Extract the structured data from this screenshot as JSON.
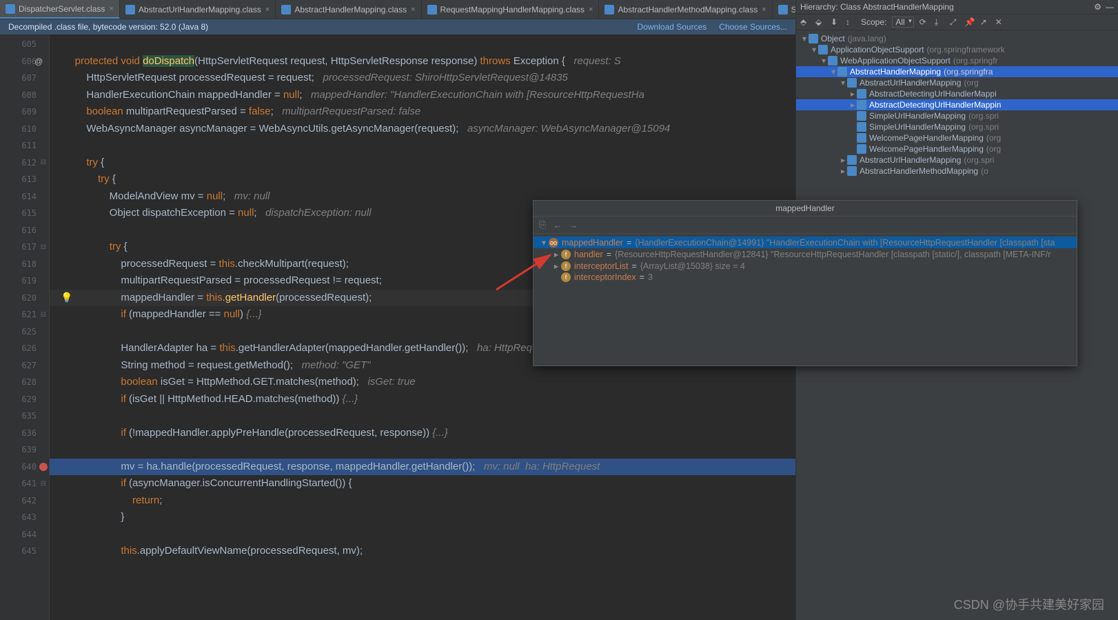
{
  "tabs": [
    {
      "name": "DispatcherServlet.class",
      "active": true
    },
    {
      "name": "AbstractUrlHandlerMapping.class"
    },
    {
      "name": "AbstractHandlerMapping.class"
    },
    {
      "name": "RequestMappingHandlerMapping.class"
    },
    {
      "name": "AbstractHandlerMethodMapping.class"
    },
    {
      "name": "S"
    }
  ],
  "banner": {
    "text": "Decompiled .class file, bytecode version: 52.0 (Java 8)",
    "link1": "Download Sources",
    "link2": "Choose Sources..."
  },
  "hierarchy": {
    "title": "Hierarchy: Class AbstractHandlerMapping",
    "scope_label": "Scope:",
    "scope_value": "All",
    "tree": [
      {
        "indent": 0,
        "arrow": "▾",
        "name": "Object",
        "pkg": "(java.lang)"
      },
      {
        "indent": 1,
        "arrow": "▾",
        "name": "ApplicationObjectSupport",
        "pkg": "(org.springframework"
      },
      {
        "indent": 2,
        "arrow": "▾",
        "name": "WebApplicationObjectSupport",
        "pkg": "(org.springfr"
      },
      {
        "indent": 3,
        "arrow": "▾",
        "name": "AbstractHandlerMapping",
        "pkg": "(org.springfra",
        "sel": true
      },
      {
        "indent": 4,
        "arrow": "▾",
        "name": "AbstractUrlHandlerMapping",
        "pkg": "(org"
      },
      {
        "indent": 5,
        "arrow": "▸",
        "name": "AbstractDetectingUrlHandlerMappi",
        "pkg": ""
      },
      {
        "indent": 5,
        "arrow": "▸",
        "name": "AbstractDetectingUrlHandlerMappin",
        "pkg": "",
        "sel": true
      },
      {
        "indent": 5,
        "arrow": "",
        "name": "SimpleUrlHandlerMapping",
        "pkg": "(org.spri"
      },
      {
        "indent": 5,
        "arrow": "",
        "name": "SimpleUrlHandlerMapping",
        "pkg": "(org.spri"
      },
      {
        "indent": 5,
        "arrow": "",
        "name": "WelcomePageHandlerMapping",
        "pkg": "(org"
      },
      {
        "indent": 5,
        "arrow": "",
        "name": "WelcomePageHandlerMapping",
        "pkg": "(org"
      },
      {
        "indent": 4,
        "arrow": "▸",
        "name": "AbstractUrlHandlerMapping",
        "pkg": "(org.spri"
      },
      {
        "indent": 4,
        "arrow": "▸",
        "name": "AbstractHandlerMethodMapping",
        "pkg": "(o"
      }
    ]
  },
  "gutter": [
    "605",
    "606",
    "607",
    "608",
    "609",
    "610",
    "611",
    "612",
    "613",
    "614",
    "615",
    "616",
    "617",
    "618",
    "619",
    "620",
    "621",
    "625",
    "626",
    "627",
    "628",
    "629",
    "635",
    "636",
    "639",
    "640",
    "641",
    "642",
    "643",
    "644",
    "645"
  ],
  "code": {
    "lines": [
      {
        "html": ""
      },
      {
        "html": "    <span class='kw'>protected void</span> <span class='fnh'>doDispatch</span>(HttpServletRequest request<span class='punc'>,</span> HttpServletResponse response) <span class='kw'>throws</span> Exception {   <span class='cmt'>request: S</span>"
      },
      {
        "html": "        HttpServletRequest processedRequest = request<span class='punc'>;</span>   <span class='cmt'>processedRequest: ShiroHttpServletRequest@14835</span>"
      },
      {
        "html": "        HandlerExecutionChain mappedHandler = <span class='kw'>null</span><span class='punc'>;</span>   <span class='cmt'>mappedHandler: \"HandlerExecutionChain with [ResourceHttpRequestHa</span>"
      },
      {
        "html": "        <span class='kw'>boolean</span> multipartRequestParsed = <span class='kw'>false</span><span class='punc'>;</span>   <span class='cmt'>multipartRequestParsed: false</span>"
      },
      {
        "html": "        WebAsyncManager asyncManager = WebAsyncUtils.getAsyncManager(request)<span class='punc'>;</span>   <span class='cmt'>asyncManager: WebAsyncManager@15094</span>"
      },
      {
        "html": ""
      },
      {
        "html": "        <span class='kw'>try</span> {"
      },
      {
        "html": "            <span class='kw'>try</span> {"
      },
      {
        "html": "                ModelAndView mv = <span class='kw'>null</span><span class='punc'>;</span>   <span class='cmt'>mv: null</span>"
      },
      {
        "html": "                Object dispatchException = <span class='kw'>null</span><span class='punc'>;</span>   <span class='cmt'>dispatchException: null</span>"
      },
      {
        "html": ""
      },
      {
        "html": "                <span class='kw'>try</span> {"
      },
      {
        "html": "                    processedRequest = <span class='kw'>this</span>.checkMultipart(request)<span class='punc'>;</span>"
      },
      {
        "html": "                    multipartRequestParsed = processedRequest != request<span class='punc'>;</span>"
      },
      {
        "html": "                    mappedHandler = <span class='kw'>this</span>.<span class='fn'>getHandler</span>(processedRequest)<span class='punc'>;</span>",
        "cursor": true
      },
      {
        "html": "                    <span class='kw'>if</span> (mappedHandler == <span class='kw'>null</span>) <span class='cmt'>{...}</span>"
      },
      {
        "html": ""
      },
      {
        "html": "                    HandlerAdapter ha = <span class='kw'>this</span>.getHandlerAdapter(mappedHandler.getHandler())<span class='punc'>;</span>   <span class='cmt'>ha: HttpRequestHandlerAd</span>"
      },
      {
        "html": "                    String method = request.getMethod()<span class='punc'>;</span>   <span class='cmt'>method: \"GET\"</span>"
      },
      {
        "html": "                    <span class='kw'>boolean</span> isGet = HttpMethod.GET.matches(method)<span class='punc'>;</span>   <span class='cmt'>isGet: true</span>"
      },
      {
        "html": "                    <span class='kw'>if</span> (isGet || HttpMethod.HEAD.matches(method)) <span class='cmt'>{...}</span>"
      },
      {
        "html": ""
      },
      {
        "html": "                    <span class='kw'>if</span> (!mappedHandler.applyPreHandle(processedRequest<span class='punc'>,</span> response)) <span class='cmt'>{...}</span>"
      },
      {
        "html": ""
      },
      {
        "html": "                    mv = ha.handle(processedRequest<span class='punc'>,</span> response<span class='punc'>,</span> mappedHandler.getHandler())<span class='punc'>;</span>   <span class='cmt'>mv: null  ha: HttpRequest</span>",
        "exec": true
      },
      {
        "html": "                    <span class='kw'>if</span> (asyncManager.isConcurrentHandlingStarted()) {"
      },
      {
        "html": "                        <span class='kw'>return</span><span class='punc'>;</span>"
      },
      {
        "html": "                    }"
      },
      {
        "html": ""
      },
      {
        "html": "                    <span class='kw'>this</span>.applyDefaultViewName(processedRequest<span class='punc'>,</span> mv)<span class='punc'>;</span>"
      }
    ]
  },
  "debug": {
    "title": "mappedHandler",
    "rows": [
      {
        "indent": 0,
        "arrow": "▾",
        "icon": "oo",
        "name": "mappedHandler",
        "val": "{HandlerExecutionChain@14991} \"HandlerExecutionChain with [ResourceHttpRequestHandler [classpath [sta",
        "sel": true
      },
      {
        "indent": 1,
        "arrow": "▸",
        "icon": "f",
        "name": "handler",
        "val": "{ResourceHttpRequestHandler@12841} \"ResourceHttpRequestHandler [classpath [static/], classpath [META-INF/r"
      },
      {
        "indent": 1,
        "arrow": "▸",
        "icon": "f",
        "name": "interceptorList",
        "val": "{ArrayList@15038}  size = 4"
      },
      {
        "indent": 1,
        "arrow": "",
        "icon": "f",
        "name": "interceptorIndex",
        "val": "3"
      }
    ]
  },
  "watermark": "CSDN @协手共建美好家园"
}
